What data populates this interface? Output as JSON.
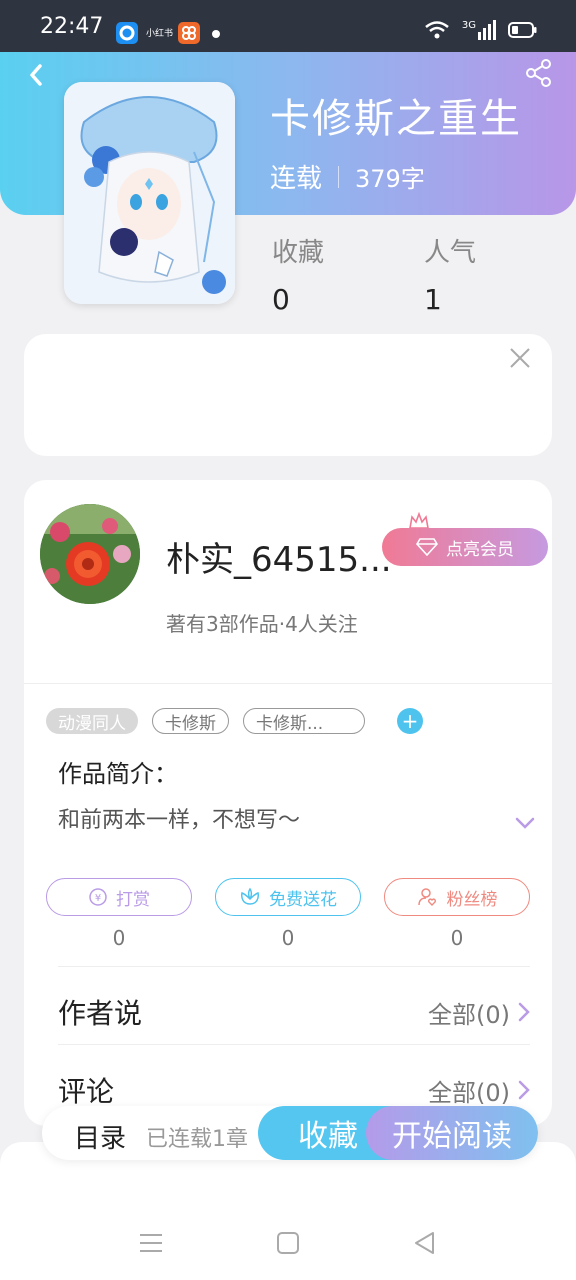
{
  "status_bar": {
    "time": "22:47",
    "app_label_tiny": "小红书",
    "icons": [
      "blue-app-icon",
      "orange-app-icon",
      "notification-dot",
      "wifi-icon",
      "signal-3g-icon",
      "battery-icon"
    ],
    "signal_label": "3G"
  },
  "header": {
    "title": "卡修斯之重生",
    "status": "连载",
    "word_count": "379字"
  },
  "stats": {
    "favorites_label": "收藏",
    "favorites_value": "0",
    "popularity_label": "人气",
    "popularity_value": "1"
  },
  "author": {
    "name": "朴实_64515...",
    "vip_button": "点亮会员",
    "info": "著有3部作品·4人关注"
  },
  "tags": [
    "动漫同人",
    "卡修斯",
    "卡修斯..."
  ],
  "intro": {
    "heading": "作品简介：",
    "text": "和前两本一样，不想写～"
  },
  "actions": [
    {
      "label": "打赏",
      "count": "0",
      "color": "#b99be6"
    },
    {
      "label": "免费送花",
      "count": "0",
      "color": "#4ec3ee"
    },
    {
      "label": "粉丝榜",
      "count": "0",
      "color": "#ef8a80"
    }
  ],
  "rows": {
    "author_says": {
      "label": "作者说",
      "link": "全部(0)"
    },
    "comments": {
      "label": "评论",
      "link": "全部(0)"
    }
  },
  "bottom_bar": {
    "toc": "目录",
    "updated": "已连载1章",
    "favorite": "收藏",
    "start_reading": "开始阅读"
  },
  "colors": {
    "accent_blue": "#54c6ef",
    "accent_purple": "#b49be9",
    "vip_pink": "#f07a95"
  }
}
